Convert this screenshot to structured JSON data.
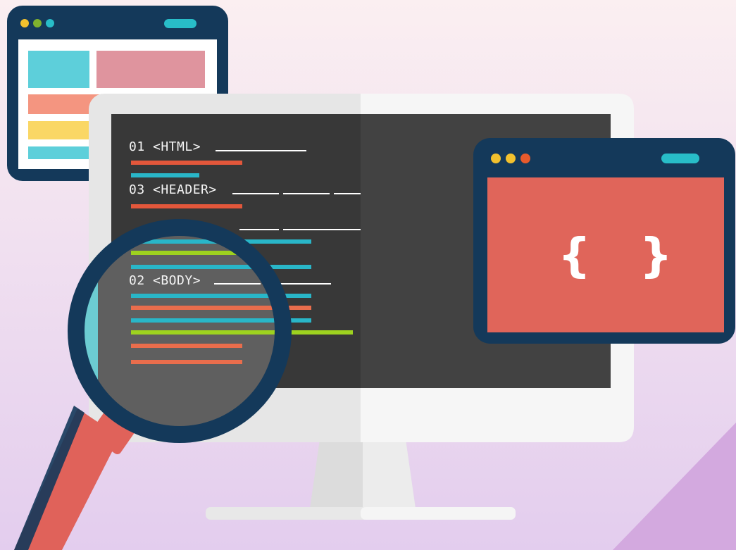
{
  "code_lines": [
    "01 <HTML>",
    "03 <HEADER>",
    "02 <BODY>"
  ],
  "braces": "{   }",
  "colors": {
    "background_top": "#fbeff1",
    "background_bottom": "#e4cff0",
    "window_frame": "#14395a",
    "editor_bg": "#3e3e3e",
    "code_red": "#e3573b",
    "code_teal": "#29b6c8",
    "code_lime": "#9ed21f",
    "code_salmon": "#e96d4c",
    "magnifier_handle": "#e0625a",
    "card_red": "#e0655a",
    "dot_yellow": "#f2c12e",
    "dot_orange": "#e75a2c",
    "dot_teal": "#28bdc8",
    "dot_green": "#7fb22e"
  },
  "icons": [
    "magnifying-glass-icon",
    "browser-window-icon",
    "code-braces-icon",
    "monitor-icon"
  ]
}
